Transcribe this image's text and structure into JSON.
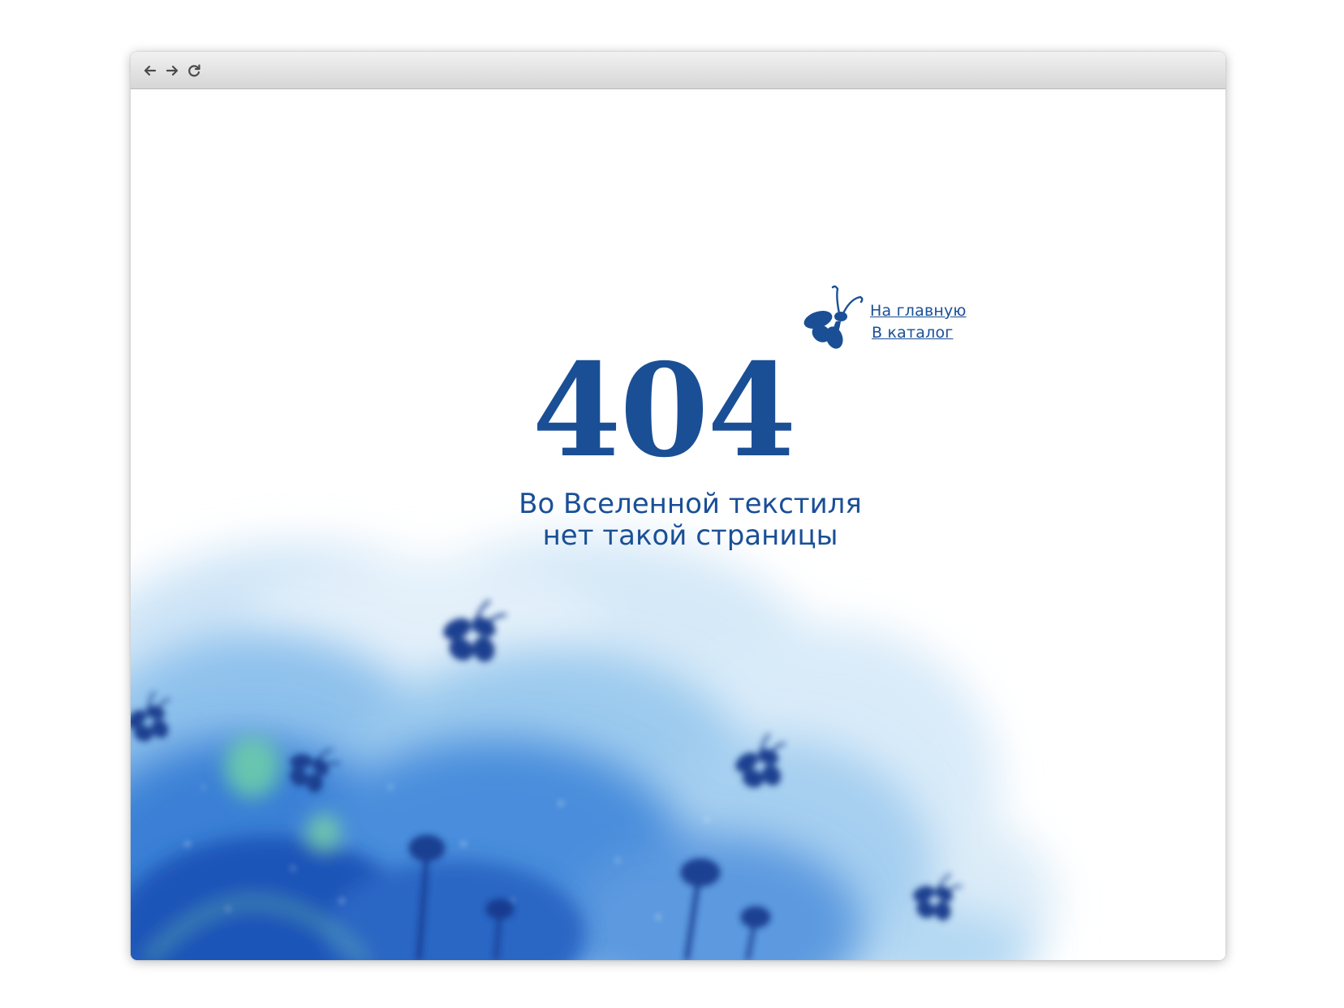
{
  "browser": {
    "nav_icons": [
      "back-arrow-icon",
      "forward-arrow-icon",
      "reload-icon"
    ]
  },
  "page": {
    "error_code": "404",
    "message_line1": "Во Вселенной текстиля",
    "message_line2": "нет такой страницы",
    "links": {
      "home": "На главную",
      "catalog": "В каталог"
    },
    "logo_icon": "butterfly-icon"
  },
  "colors": {
    "brand_blue": "#1a4f96",
    "toolbar_top": "#f1f1f1",
    "toolbar_bottom": "#d6d6d6",
    "background": "#ffffff"
  }
}
